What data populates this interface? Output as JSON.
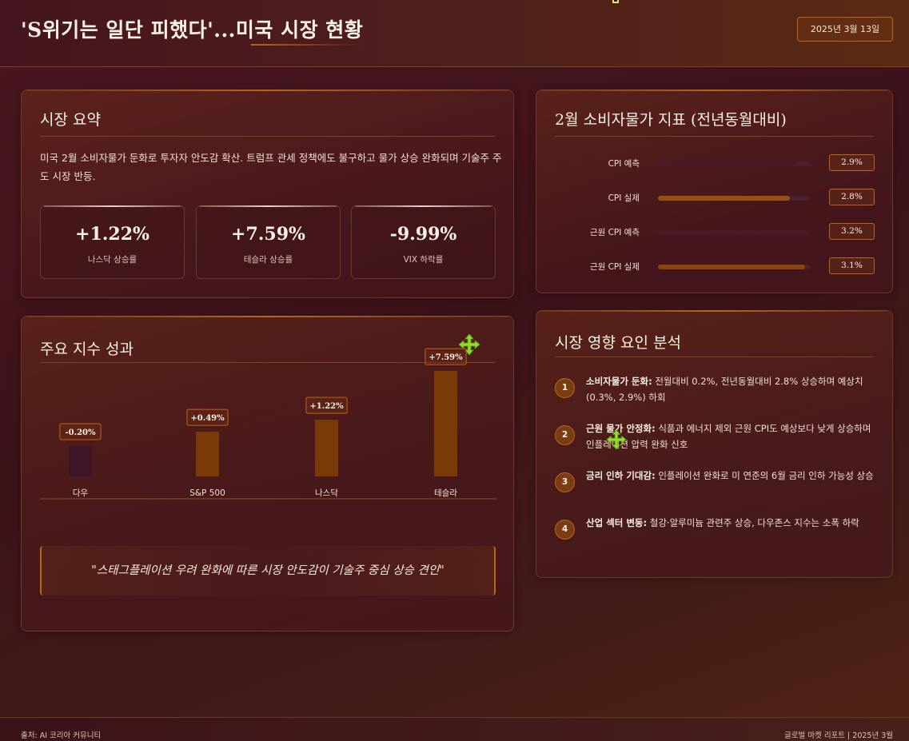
{
  "header": {
    "title": "'S위기는 일단 피했다'...미국 시장 현황",
    "date": "2025년 3월 13일"
  },
  "summary": {
    "title": "시장 요약",
    "text": "미국 2월 소비자물가 둔화로 투자자 안도감 확산. 트럼프 관세 정책에도 불구하고 물가 상승 완화되며 기술주 주도 시장 반등.",
    "stats": [
      {
        "value": "+1.22%",
        "label": "나스닥 상승률"
      },
      {
        "value": "+7.59%",
        "label": "테슬라 상승률"
      },
      {
        "value": "-9.99%",
        "label": "VIX 하락률"
      }
    ]
  },
  "cpi": {
    "title": "2월 소비자물가 지표 (전년동월대비)",
    "rows": [
      {
        "label": "CPI 예측",
        "value": "2.9%",
        "level": 0.91,
        "color": "#4a1a26"
      },
      {
        "label": "CPI 실제",
        "value": "2.8%",
        "level": 0.87,
        "color": "#9a5012"
      },
      {
        "label": "근원 CPI 예측",
        "value": "3.2%",
        "level": 1.0,
        "color": "#4a1a26"
      },
      {
        "label": "근원 CPI 실제",
        "value": "3.1%",
        "level": 0.97,
        "color": "#8a4410"
      }
    ]
  },
  "indices": {
    "title": "주요 지수 성과",
    "quote": "\"스태그플레이션 우려 완화에 따른 시장 안도감이 기술주 중심 상승 견인\""
  },
  "chart_data": {
    "type": "bar",
    "categories": [
      "다우",
      "S&P 500",
      "나스닥",
      "테슬라"
    ],
    "values": [
      -0.2,
      0.49,
      1.22,
      7.59
    ],
    "data_labels": [
      "-0.20%",
      "+0.49%",
      "+1.22%",
      "+7.59%"
    ],
    "title": "",
    "xlabel": "",
    "ylabel": "",
    "colors": {
      "positive": "#7a3a08",
      "negative": "#3e1526"
    }
  },
  "factors": {
    "title": "시장 영향 요인 분석",
    "items": [
      {
        "num": "1",
        "head": "소비자물가 둔화:",
        "body": " 전월대비 0.2%, 전년동월대비 2.8% 상승하며 예상치(0.3%, 2.9%) 하회"
      },
      {
        "num": "2",
        "head": "근원 물가 안정화:",
        "body": " 식품과 에너지 제외 근원 CPI도 예상보다 낮게 상승하며 인플레이션 압력 완화 신호"
      },
      {
        "num": "3",
        "head": "금리 인하 기대감:",
        "body": " 인플레이션 완화로 미 연준의 6월 금리 인하 가능성 상승"
      },
      {
        "num": "4",
        "head": "산업 섹터 변동:",
        "body": " 철강·알루미늄 관련주 상승, 다우존스 지수는 소폭 하락"
      }
    ]
  },
  "footer": {
    "source": "출처: AI 코리아 커뮤니티",
    "report": "글로벌 마켓 리포트 | 2025년 3월"
  },
  "colors": {
    "accent": "#b9661a",
    "move_icon": "#8fdc2c"
  }
}
